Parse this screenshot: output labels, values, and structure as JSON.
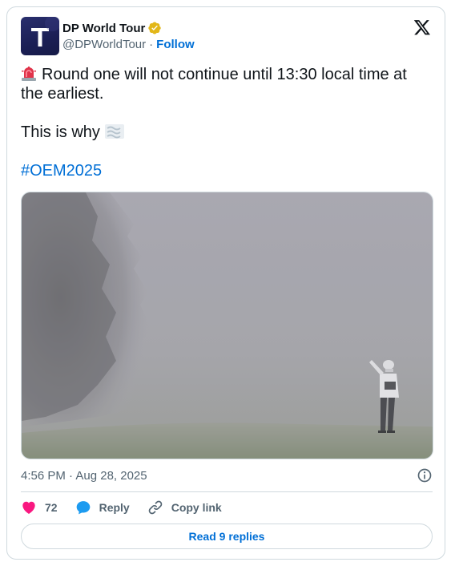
{
  "author": {
    "display_name": "DP World Tour",
    "handle": "@DPWorldTour",
    "separator": "·",
    "follow_label": "Follow",
    "verified_color": "#e2b719",
    "avatar_letter": "T"
  },
  "tweet": {
    "line1": "Round one will not continue until 13:30 local time at the earliest.",
    "line2": "This is why",
    "hashtag": "#OEM2025",
    "emojis": [
      "rotating-light",
      "fog"
    ]
  },
  "meta": {
    "timestamp": "4:56 PM · Aug 28, 2025"
  },
  "actions": {
    "like_count": "72",
    "reply_label": "Reply",
    "copy_link_label": "Copy link",
    "read_replies_label": "Read 9 replies"
  },
  "colors": {
    "link": "#006fd6",
    "like": "#f91880",
    "reply": "#1d9bf0",
    "muted": "#536471",
    "border": "#cfd9de"
  }
}
